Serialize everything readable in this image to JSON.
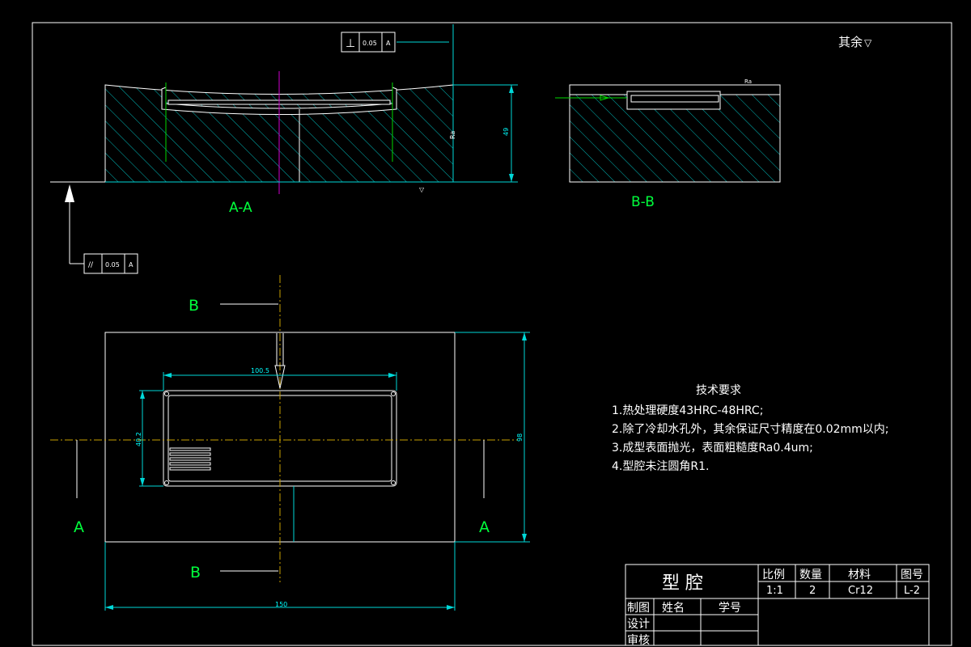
{
  "views": {
    "section_aa_label": "A-A",
    "section_bb_label": "B-B",
    "cut_a_left": "A",
    "cut_a_right": "A",
    "cut_b_top": "B",
    "cut_b_bottom": "B"
  },
  "tolerances": {
    "perpendicularity": {
      "symbol": "⊥",
      "value": "0.05",
      "datum": "A"
    },
    "parallelism": {
      "symbol": "//",
      "value": "0.05",
      "datum": "A"
    }
  },
  "roughness_note": "其余",
  "dimensions": {
    "height_aa": "49",
    "slot_length": "100.5",
    "slot_width": "40.2",
    "overall_width": "150",
    "overall_height": "98"
  },
  "tech_requirements": {
    "title": "技术要求",
    "items": [
      "1.热处理硬度43HRC-48HRC;",
      "2.除了冷却水孔外，其余保证尺寸精度在0.02mm以内;",
      "3.成型表面抛光，表面粗糙度Ra0.4um;",
      "4.型腔未注圆角R1."
    ]
  },
  "title_block": {
    "part_name": "型  腔",
    "scale_label": "比例",
    "scale_value": "1:1",
    "qty_label": "数量",
    "qty_value": "2",
    "material_label": "材料",
    "material_value": "Cr12",
    "drawing_no_label": "图号",
    "drawing_no_value": "L-2",
    "drawn_label": "制图",
    "name_label": "姓名",
    "student_no_label": "学号",
    "design_label": "设计",
    "review_label": "审核"
  }
}
